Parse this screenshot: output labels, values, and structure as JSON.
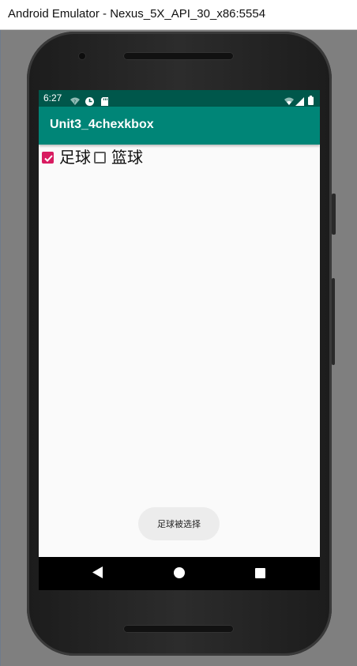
{
  "window": {
    "title": "Android Emulator - Nexus_5X_API_30_x86:5554"
  },
  "statusbar": {
    "time": "6:27",
    "icons": [
      "wifi-question-icon",
      "gear-notification-icon",
      "sd-card-icon",
      "wifi-icon",
      "cell-signal-icon",
      "battery-icon"
    ]
  },
  "app": {
    "title": "Unit3_4chexkbox"
  },
  "checkboxes": [
    {
      "label": "足球",
      "checked": true
    },
    {
      "label": "篮球",
      "checked": false
    }
  ],
  "toast": {
    "text": "足球被选择"
  },
  "navbar": {
    "buttons": [
      "back-icon",
      "home-icon",
      "recents-icon"
    ]
  },
  "colors": {
    "statusbar": "#00574b",
    "appbar": "#008577",
    "accent": "#d81b60",
    "screen_bg": "#fafafa"
  }
}
